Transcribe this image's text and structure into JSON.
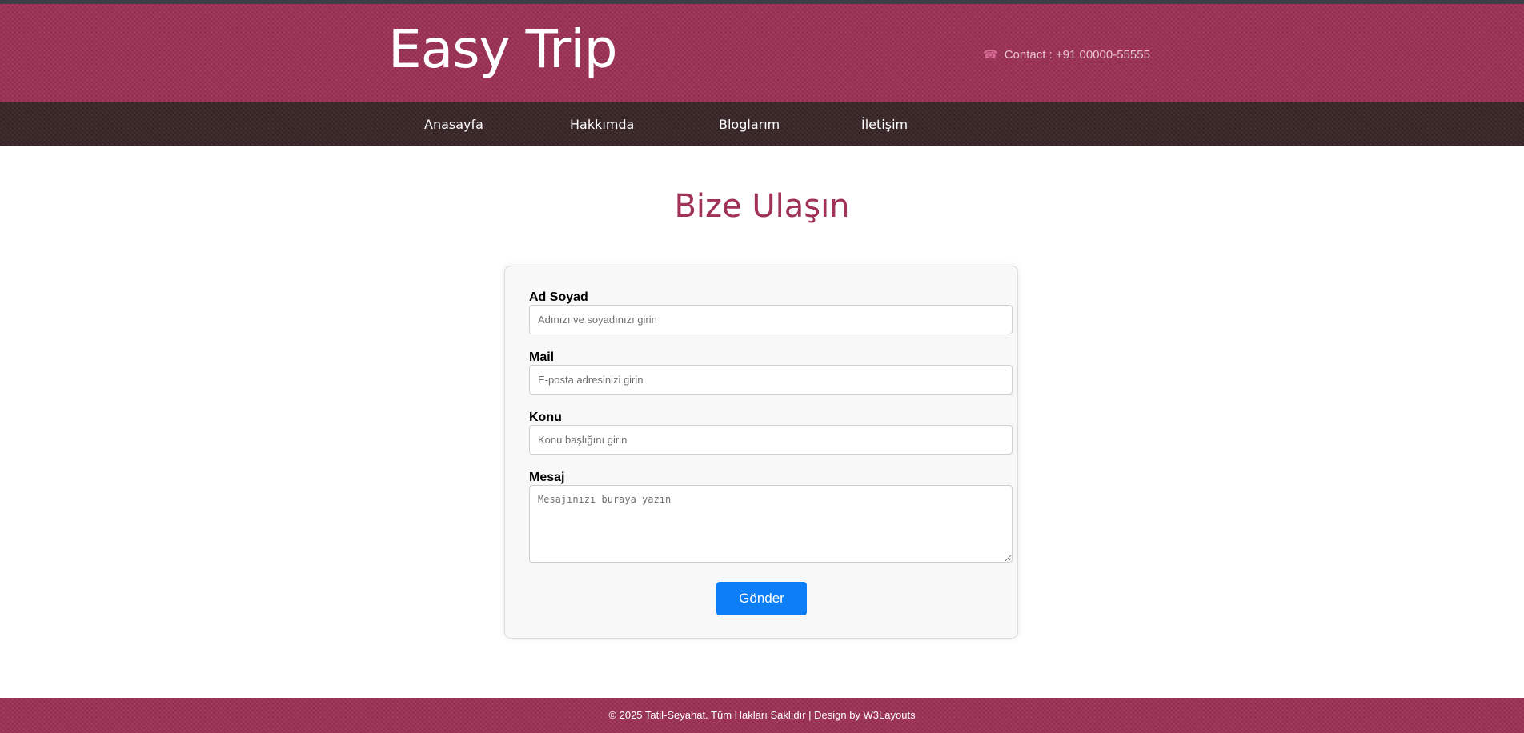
{
  "header": {
    "logo": "Easy Trip",
    "contact_icon": "phone-icon",
    "contact_icon_glyph": "☎",
    "contact_text": "Contact : +91 00000-55555"
  },
  "nav": {
    "items": [
      {
        "label": "Anasayfa"
      },
      {
        "label": "Hakkımda"
      },
      {
        "label": "Bloglarım"
      },
      {
        "label": "İletişim"
      }
    ]
  },
  "page": {
    "title": "Bize Ulaşın"
  },
  "form": {
    "name_label": "Ad Soyad",
    "name_placeholder": "Adınızı ve soyadınızı girin",
    "mail_label": "Mail",
    "mail_placeholder": "E-posta adresinizi girin",
    "subject_label": "Konu",
    "subject_placeholder": "Konu başlığını girin",
    "message_label": "Mesaj",
    "message_placeholder": "Mesajınızı buraya yazın",
    "submit_label": "Gönder"
  },
  "footer": {
    "text": "© 2025 Tatil-Seyahat. Tüm Hakları Saklıdır | Design by W3Layouts"
  },
  "colors": {
    "header_bg": "#9c2f55",
    "nav_bg": "#382526",
    "title_color": "#a03157",
    "button_bg": "#0d7ef5"
  }
}
